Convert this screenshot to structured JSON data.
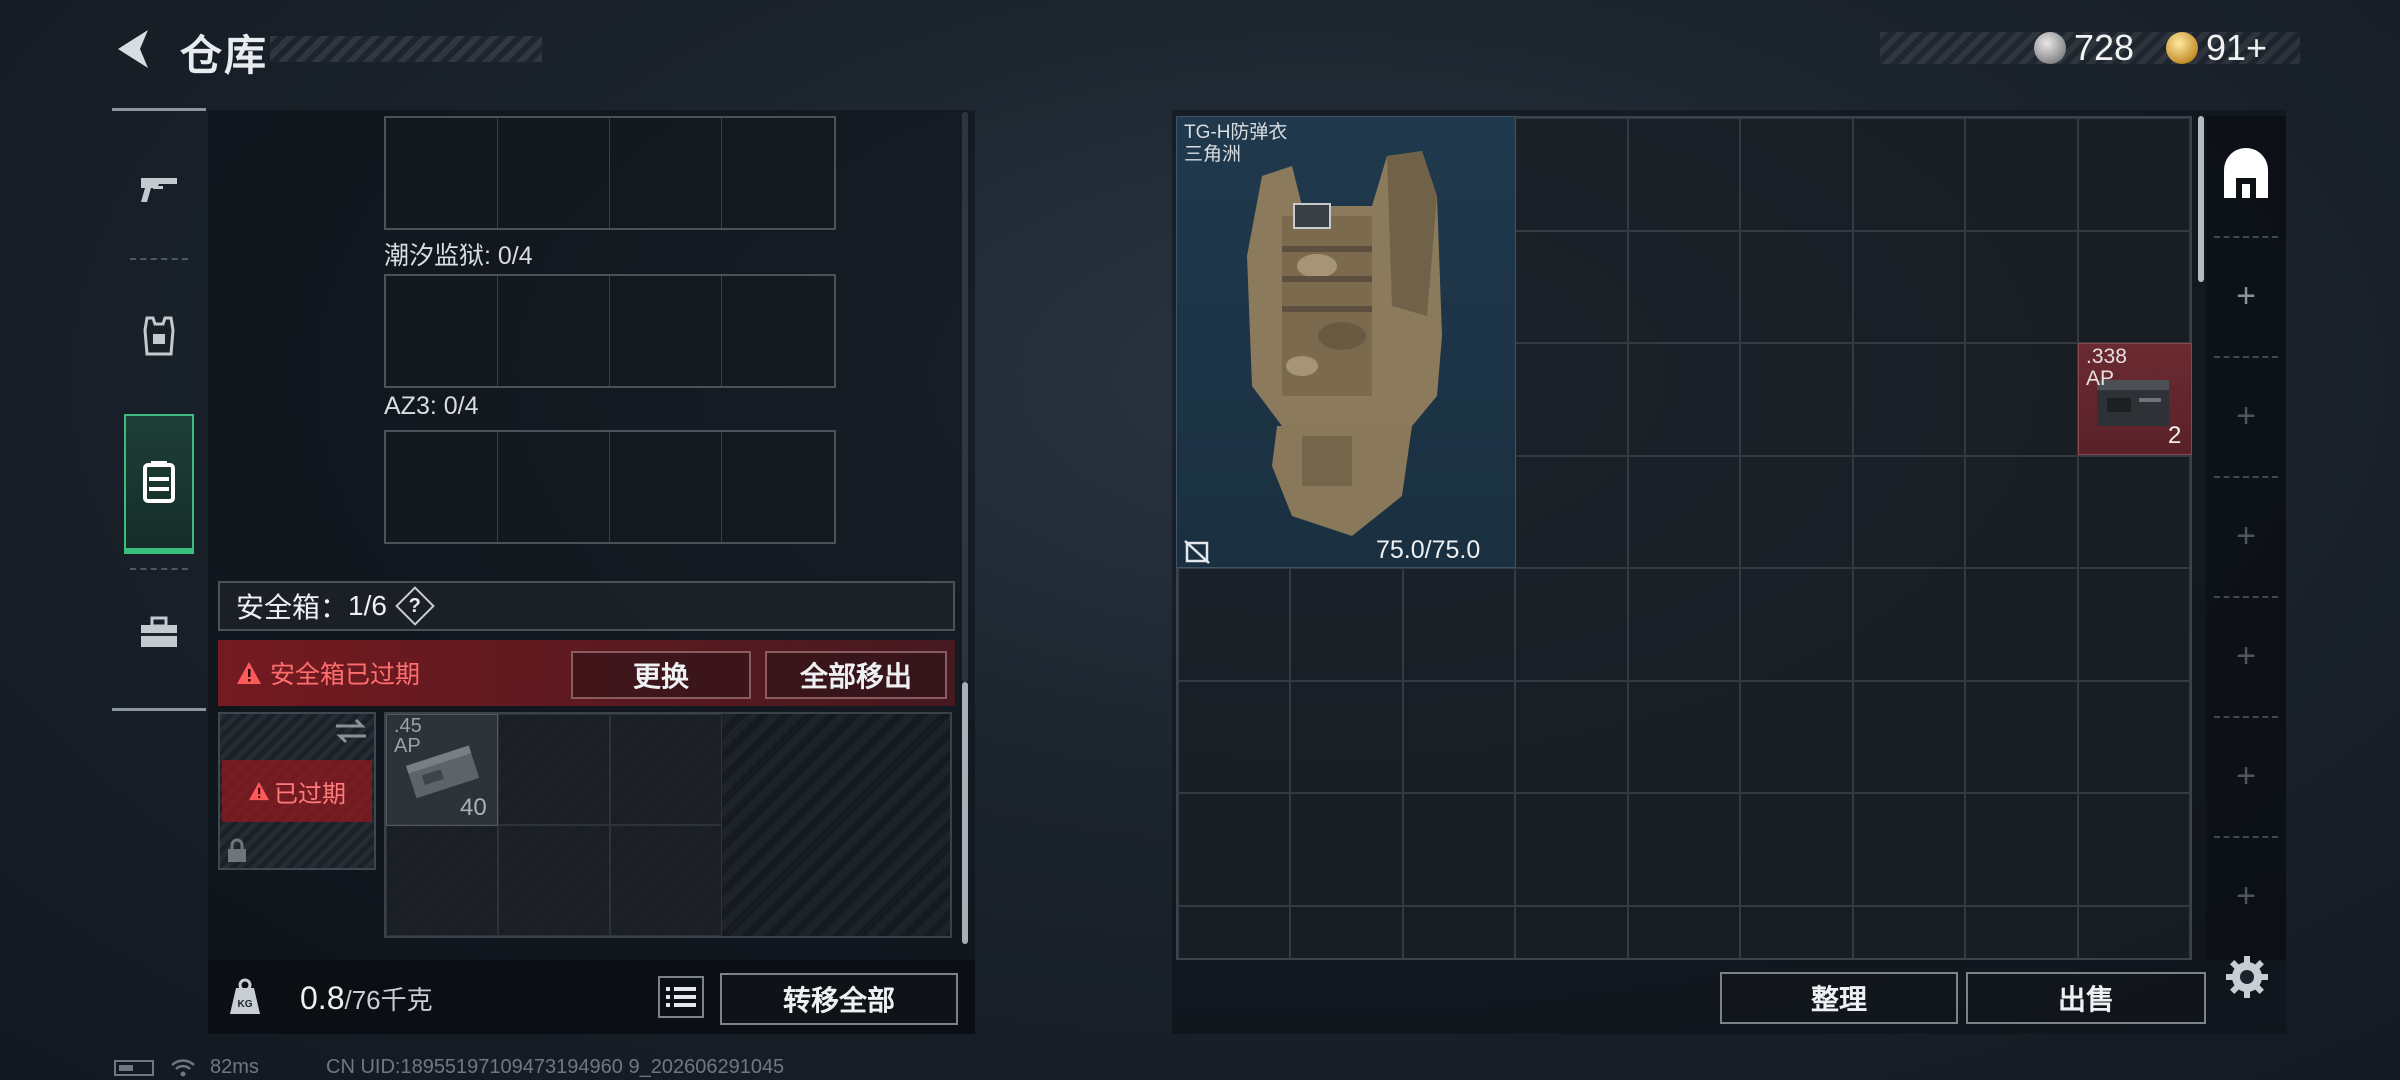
{
  "header": {
    "title": "仓库",
    "currencies": [
      {
        "icon": "silver-coin-icon",
        "value": "728"
      },
      {
        "icon": "gold-coin-icon",
        "value": "91+"
      }
    ]
  },
  "nav": [
    {
      "name": "weapons",
      "icon": "pistol-icon",
      "active": false
    },
    {
      "name": "gear",
      "icon": "armor-vest-icon",
      "active": false
    },
    {
      "name": "containers",
      "icon": "container-icon",
      "active": true
    },
    {
      "name": "tools",
      "icon": "toolbox-icon",
      "active": false
    }
  ],
  "left": {
    "slot_groups": [
      {
        "label": "潮汐监狱: 0/4"
      },
      {
        "label": "AZ3: 0/4"
      }
    ],
    "safe_box": {
      "label": "安全箱：",
      "count": "1/6",
      "help": "?",
      "expired_banner": "安全箱已过期",
      "replace_button": "更换",
      "move_all_button": "全部移出",
      "case_status": "已过期",
      "item": {
        "name": ".45\nAP",
        "count": "40"
      }
    },
    "weight": {
      "current": "0.8",
      "capacity": "/76千克"
    },
    "transfer_all_button": "转移全部"
  },
  "right": {
    "vest": {
      "name_line1": "TG-H防弹衣",
      "name_line2": "三角洲",
      "durability": "75.0/75.0"
    },
    "ammo": {
      "name": ".338\nAP",
      "count": "2"
    },
    "sort_button": "整理",
    "sell_button": "出售"
  },
  "status": {
    "ping": "82ms",
    "uid": "CN UID:18955197109473194960 9_202606291045"
  },
  "colors": {
    "accent_green": "#38c07c",
    "expired_red": "#ff6e6e",
    "ammo_red": "#6b2a32"
  }
}
